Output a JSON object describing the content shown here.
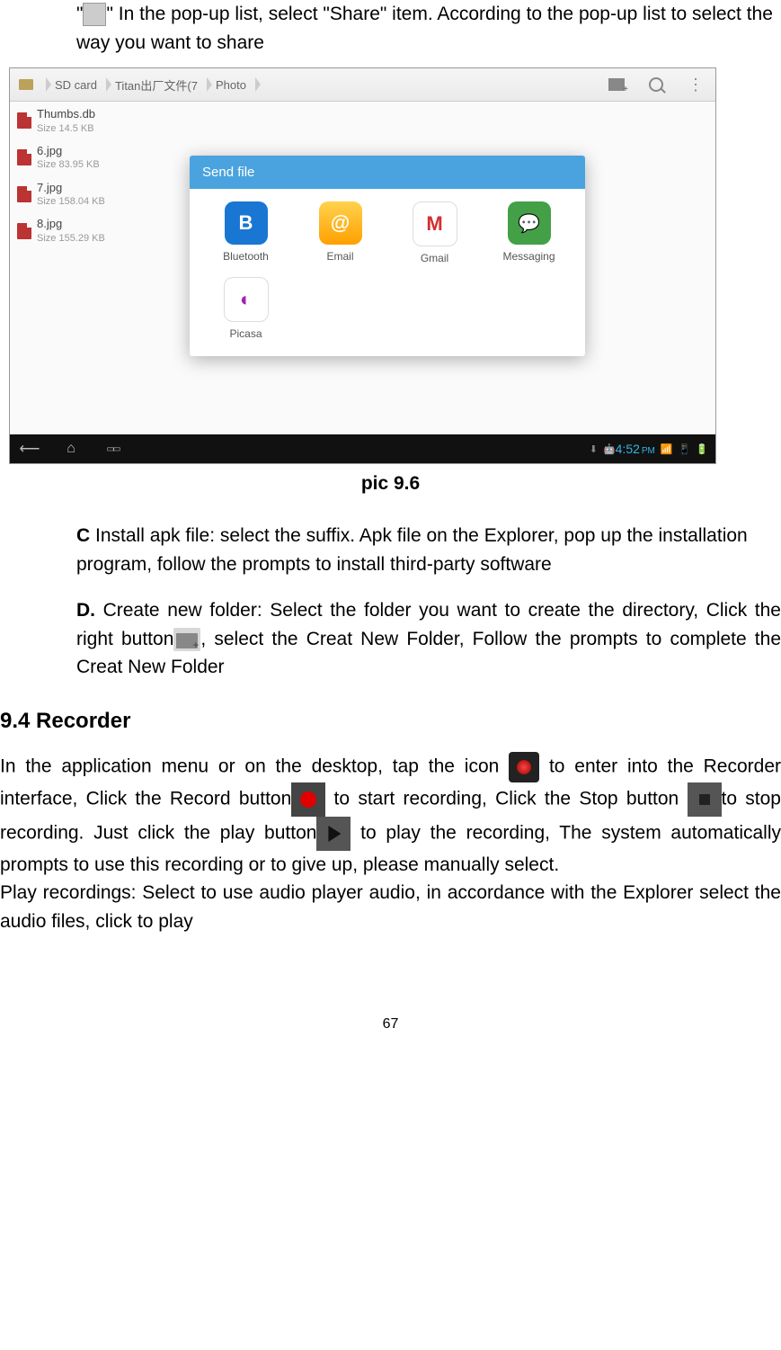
{
  "intro_text_1a": "\"",
  "intro_text_1b": "\" In the pop-up list, select \"Share\" item. According to the pop-up list to select the way you want to share",
  "screenshot": {
    "breadcrumb": [
      "SD card",
      "Titan出厂文件(7",
      "Photo"
    ],
    "files": [
      {
        "name": "Thumbs.db",
        "size": "Size 14.5 KB"
      },
      {
        "name": "6.jpg",
        "size": "Size 83.95 KB"
      },
      {
        "name": "7.jpg",
        "size": "Size 158.04 KB"
      },
      {
        "name": "8.jpg",
        "size": "Size 155.29 KB"
      }
    ],
    "dialog_title": "Send file",
    "apps": [
      "Bluetooth",
      "Email",
      "Gmail",
      "Messaging",
      "Picasa"
    ],
    "clock": "4:52",
    "clock_ampm": "PM"
  },
  "caption": "pic 9.6",
  "section_c_bold": "C",
  "section_c_text": " Install apk file: select the suffix. Apk file on the Explorer, pop up the installation program, follow the prompts to install third-party software",
  "section_d_bold": "D.",
  "section_d_text_1": " Create new folder: Select the folder you want to create the directory, Click the right button",
  "section_d_text_2": ", select the Creat New Folder, Follow the prompts to complete the Creat New Folder",
  "heading_94": "9.4 Recorder",
  "rec_1": "In the application menu or on the desktop, tap the icon ",
  "rec_2": " to enter into the Recorder interface, Click the Record button",
  "rec_3": " to start recording, Click the Stop button ",
  "rec_4": "to stop recording. Just click the play button",
  "rec_5": " to play the recording, The system automatically prompts to use this recording or to give up, please manually select.",
  "rec_6": "Play recordings: Select to use audio player audio, in accordance with the Explorer select the audio files, click to play",
  "page_number": "67"
}
